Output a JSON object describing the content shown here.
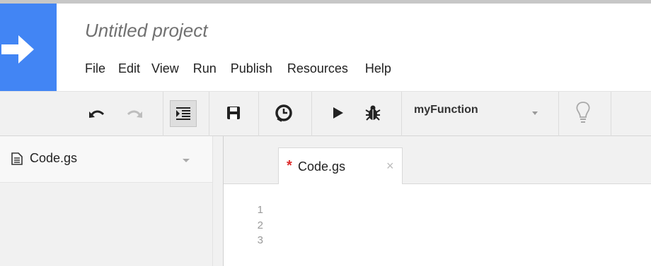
{
  "project": {
    "title": "Untitled project"
  },
  "menu": {
    "items": [
      "File",
      "Edit",
      "View",
      "Run",
      "Publish",
      "Resources",
      "Help"
    ]
  },
  "toolbar": {
    "function_select": "myFunction",
    "icons": [
      "undo-icon",
      "redo-icon",
      "indent-icon",
      "save-icon",
      "clock-trigger-icon",
      "run-play-icon",
      "debug-bug-icon",
      "lightbulb-icon"
    ]
  },
  "files": {
    "items": [
      {
        "name": "Code.gs"
      }
    ]
  },
  "editor": {
    "tab": {
      "name": "Code.gs",
      "unsaved_marker": "*",
      "close": "×"
    },
    "line_numbers": [
      "1",
      "2",
      "3"
    ]
  },
  "colors": {
    "logo": "#4285f4",
    "toolbar_bg": "#f1f1f1",
    "unsaved_marker": "#dd2c2c"
  }
}
